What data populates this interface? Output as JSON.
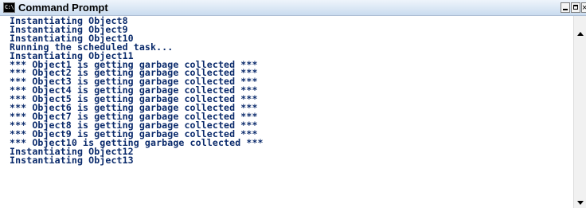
{
  "window": {
    "title": "Command Prompt",
    "icon": "console-icon",
    "icon_label": "C:\\",
    "close_glyph": "×"
  },
  "console": {
    "lines": [
      "Instantiating Object8",
      "Instantiating Object9",
      "Instantiating Object10",
      "Running the scheduled task...",
      "Instantiating Object11",
      "*** Object1 is getting garbage collected ***",
      "*** Object2 is getting garbage collected ***",
      "*** Object3 is getting garbage collected ***",
      "*** Object4 is getting garbage collected ***",
      "*** Object5 is getting garbage collected ***",
      "*** Object6 is getting garbage collected ***",
      "*** Object7 is getting garbage collected ***",
      "*** Object8 is getting garbage collected ***",
      "*** Object9 is getting garbage collected ***",
      "*** Object10 is getting garbage collected ***",
      "Instantiating Object12",
      "Instantiating Object13"
    ]
  },
  "colors": {
    "text": "#0a2a6b",
    "background": "#ffffff",
    "titlebar": "#d9e6f4"
  }
}
